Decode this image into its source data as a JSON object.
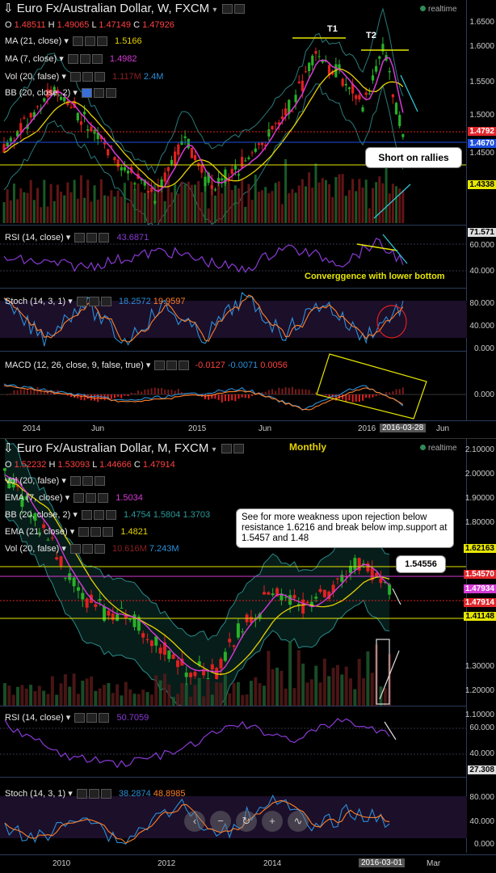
{
  "weekly": {
    "title": "Euro Fx/Australian Dollar, W, FXCM",
    "realtime": "realtime",
    "ohlc": {
      "o_label": "O",
      "o": "1.48511",
      "h_label": "H",
      "h": "1.49065",
      "l_label": "L",
      "l": "1.47149",
      "c_label": "C",
      "c": "1.47926"
    },
    "studies": [
      {
        "name": "MA (21, close)",
        "value": "1.5166",
        "color": "#e6d200"
      },
      {
        "name": "MA (7, close)",
        "value": "1.4982",
        "color": "#d63ad6"
      },
      {
        "name": "Vol (20, false)",
        "value": "1.117M",
        "value2": "2.4M",
        "color": "#8b2020",
        "color2": "#2b8fd8"
      },
      {
        "name": "BB (20, close, 2)",
        "value": ""
      }
    ],
    "y_ticks": [
      "1.6500",
      "1.6000",
      "1.5500",
      "1.5000",
      "1.4500"
    ],
    "price_tags": [
      {
        "text": "1.4792",
        "bg": "#e0262b",
        "fg": "#fff"
      },
      {
        "text": "1.4670",
        "bg": "#1e50e0",
        "fg": "#fff"
      },
      {
        "text": "1.4338",
        "bg": "#e6e600",
        "fg": "#000"
      }
    ],
    "annotations": {
      "t1": "T1",
      "t2": "T2",
      "short": "Short on rallies"
    },
    "rsi": {
      "name": "RSI (14, close)",
      "value": "43.6871",
      "ticks": [
        "60.000",
        "40.000"
      ],
      "tag": "71.571",
      "note": "Converggence with lower bottom"
    },
    "stoch": {
      "name": "Stoch (14, 3, 1)",
      "v1": "18.2572",
      "v2": "19.9597",
      "ticks": [
        "80.000",
        "40.000",
        "0.000"
      ]
    },
    "macd": {
      "name": "MACD (12, 26, close, 9, false, true)",
      "v1": "-0.0127",
      "v2": "-0.0071",
      "v3": "0.0056",
      "ticks": [
        "0.000"
      ]
    },
    "x_ticks": [
      "2014",
      "Jun",
      "2015",
      "Jun",
      "2016",
      "2016-03-28",
      "Jun"
    ],
    "colors": {
      "up": "#28b028",
      "down": "#e02020",
      "ma21": "#e6d200",
      "ma7": "#d63ad6",
      "bb": "#2a7a7a",
      "rsi": "#8a3ad6",
      "stochK": "#2b8fd8",
      "stochD": "#ff7f27"
    }
  },
  "monthly": {
    "title": "Euro Fx/Australian Dollar, M, FXCM",
    "subtitle": "Monthly",
    "realtime": "realtime",
    "ohlc": {
      "o_label": "O",
      "o": "1.52232",
      "h_label": "H",
      "h": "1.53093",
      "l_label": "L",
      "l": "1.44666",
      "c_label": "C",
      "c": "1.47914"
    },
    "studies": [
      {
        "name": "Vol (20, false)",
        "value": ""
      },
      {
        "name": "EMA (7, close)",
        "value": "1.5034",
        "color": "#d63ad6"
      },
      {
        "name": "BB (20, close, 2)",
        "value": "1.4754",
        "value2": "1.5804",
        "value3": "1.3703",
        "color": "#2a8a8a"
      },
      {
        "name": "EMA (21, close)",
        "value": "1.4821",
        "color": "#e6d200"
      },
      {
        "name": "Vol (20, false)",
        "value": "10.616M",
        "value2": "7.243M",
        "color": "#8b2020",
        "color2": "#2b8fd8"
      }
    ],
    "y_ticks": [
      "2.10000",
      "2.00000",
      "1.90000",
      "1.80000",
      "1.30000",
      "1.20000",
      "1.10000"
    ],
    "price_tags": [
      {
        "text": "1.62163",
        "bg": "#e6e600",
        "fg": "#000"
      },
      {
        "text": "1.54570",
        "bg": "#e0262b",
        "fg": "#fff"
      },
      {
        "text": "1.47934",
        "bg": "#d63ad6",
        "fg": "#fff"
      },
      {
        "text": "1.47914",
        "bg": "#e0262b",
        "fg": "#fff"
      },
      {
        "text": "1.41148",
        "bg": "#e6e600",
        "fg": "#000"
      }
    ],
    "callout": "See for more weakness upon rejection below resistance 1.6216 and break below imp.support at 1.5457 and 1.48",
    "callout2": "1.54556",
    "rsi": {
      "name": "RSI (14, close)",
      "value": "50.7059",
      "ticks": [
        "60.000",
        "40.000"
      ],
      "tag": "27.308"
    },
    "stoch": {
      "name": "Stoch (14, 3, 1)",
      "v1": "38.2874",
      "v2": "48.8985",
      "ticks": [
        "80.000",
        "40.000",
        "0.000"
      ]
    },
    "x_ticks": [
      "2010",
      "2012",
      "2014",
      "2016-03-01",
      "Mar"
    ],
    "toolbar": [
      "zoom-out",
      "minus",
      "reset",
      "plus",
      "draw"
    ]
  }
}
